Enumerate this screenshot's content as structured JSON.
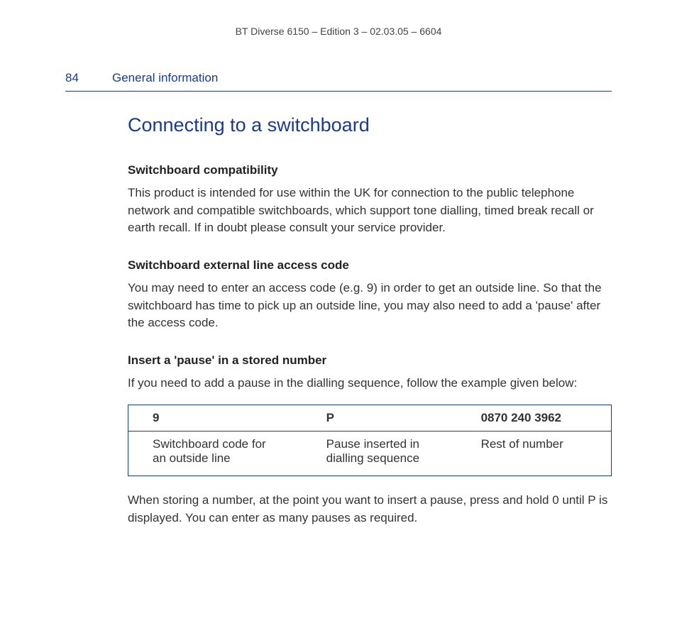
{
  "header": {
    "text": "BT Diverse 6150 – Edition 3 – 02.03.05 – 6604"
  },
  "section": {
    "pageNumber": "84",
    "label": "General information"
  },
  "mainHeading": "Connecting to a switchboard",
  "sec1": {
    "heading": "Switchboard compatibility",
    "body": "This product is intended for use within the UK for connection to the public telephone network and compatible switchboards, which support tone dialling, timed break recall or earth recall. If in doubt please consult your service provider."
  },
  "sec2": {
    "heading": "Switchboard external line access code",
    "body": "You may need to enter an access code (e.g. 9) in order to get an outside line. So that the switchboard has time to pick up an outside line, you may also need to add a 'pause' after the access code."
  },
  "sec3": {
    "heading": "Insert a 'pause' in a stored number",
    "intro": "If you need to add a pause in the dialling sequence, follow the example given below:",
    "table": {
      "headers": [
        "9",
        "P",
        "0870 240 3962"
      ],
      "row": [
        "Switchboard code for an outside line",
        "Pause inserted in dialling sequence",
        "Rest of number"
      ]
    },
    "after": "When storing a number, at the point you want to insert a pause, press and hold 0 until P is displayed. You can enter as many pauses as required."
  }
}
